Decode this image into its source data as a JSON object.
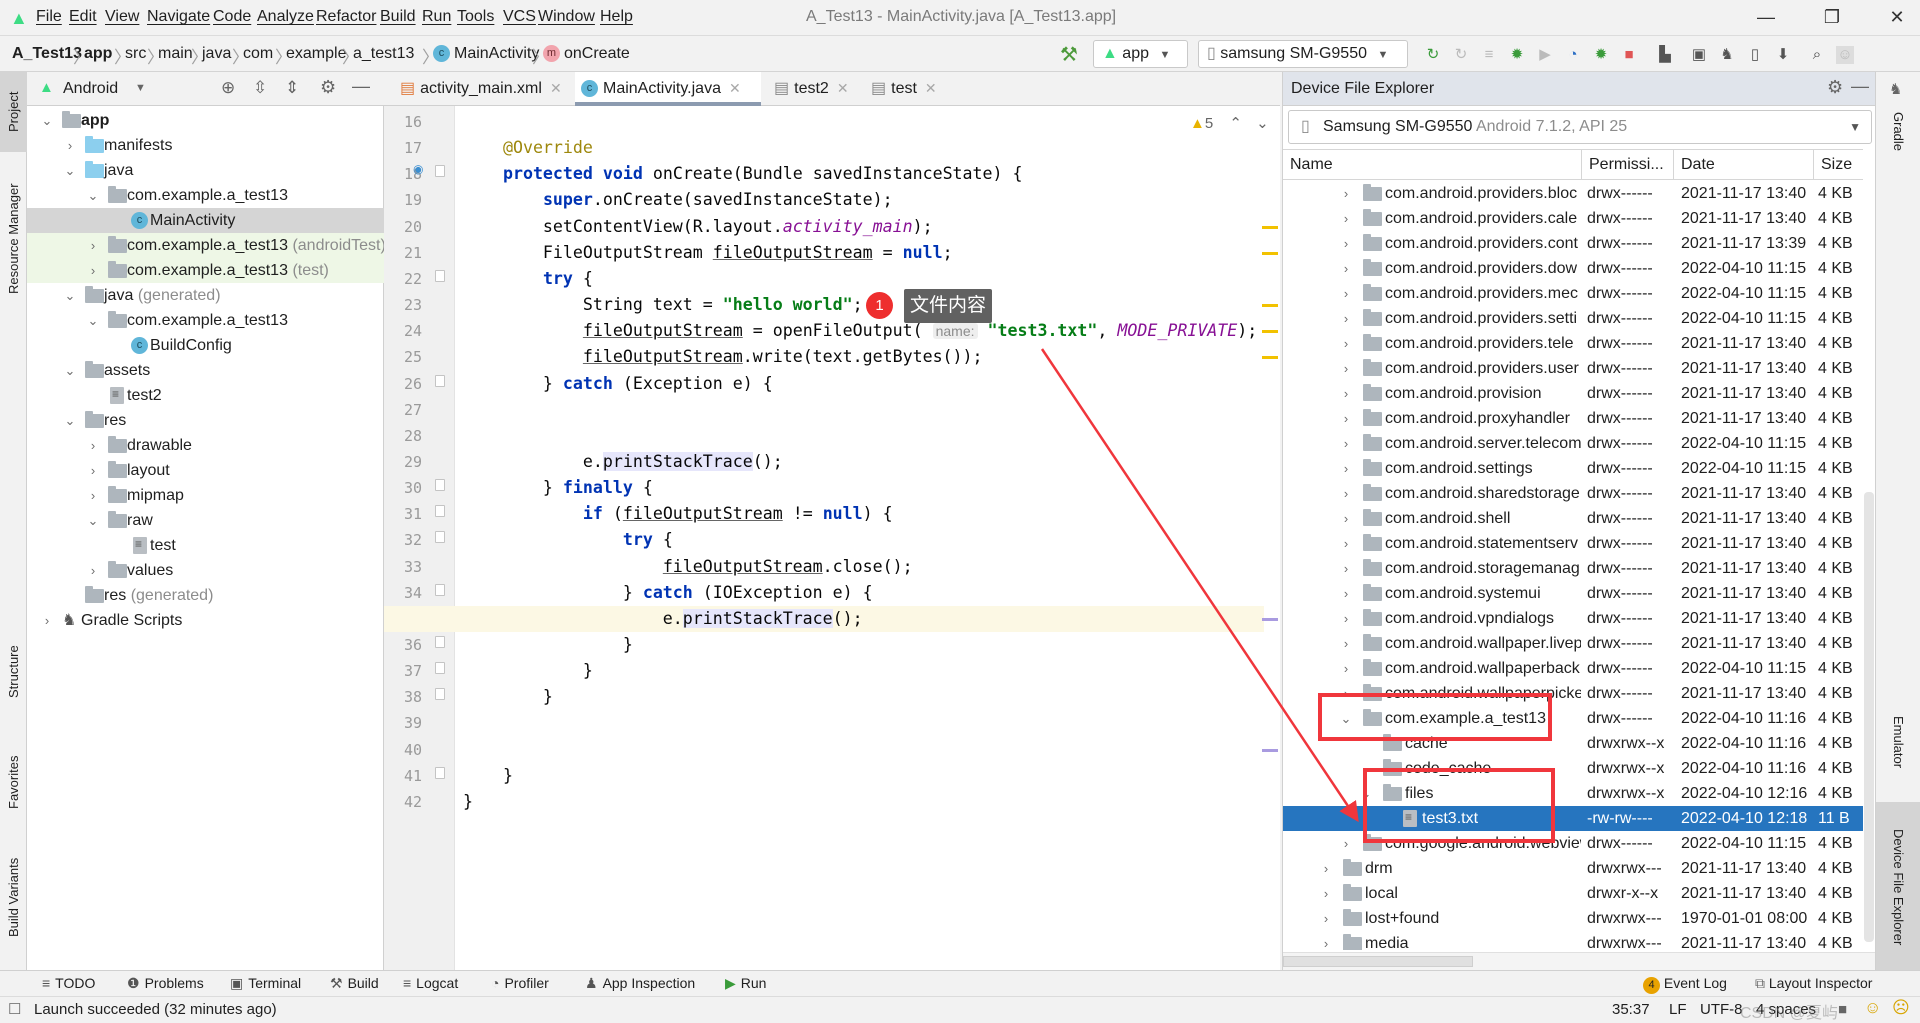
{
  "window": {
    "title": "A_Test13 - MainActivity.java [A_Test13.app]",
    "minimize": "—",
    "maximize": "❐",
    "close": "✕"
  },
  "menu": [
    "File",
    "Edit",
    "View",
    "Navigate",
    "Code",
    "Analyze",
    "Refactor",
    "Build",
    "Run",
    "Tools",
    "VCS",
    "Window",
    "Help"
  ],
  "breadcrumb": [
    "A_Test13",
    "app",
    "src",
    "main",
    "java",
    "com",
    "example",
    "a_test13",
    "MainActivity",
    "onCreate"
  ],
  "toolbar": {
    "run_config": "app",
    "device": "samsung SM-G9550"
  },
  "left_strip": {
    "project": "Project",
    "resource_manager": "Resource Manager",
    "structure": "Structure",
    "favorites": "Favorites",
    "build_variants": "Build Variants"
  },
  "project_panel": {
    "view": "Android",
    "tree": [
      {
        "d": 0,
        "exp": true,
        "icon": "module",
        "name": "app",
        "bold": true
      },
      {
        "d": 1,
        "exp": false,
        "icon": "folder-blue",
        "name": "manifests"
      },
      {
        "d": 1,
        "exp": true,
        "icon": "folder-blue",
        "name": "java"
      },
      {
        "d": 2,
        "exp": true,
        "icon": "package",
        "name": "com.example.a_test13"
      },
      {
        "d": 3,
        "icon": "class",
        "name": "MainActivity",
        "selected": true
      },
      {
        "d": 2,
        "exp": false,
        "icon": "package",
        "name": "com.example.a_test13",
        "sub": "(androidTest)",
        "green": true
      },
      {
        "d": 2,
        "exp": false,
        "icon": "package",
        "name": "com.example.a_test13",
        "sub": "(test)",
        "green": true
      },
      {
        "d": 1,
        "exp": true,
        "icon": "folder-gen",
        "name": "java",
        "sub": "(generated)"
      },
      {
        "d": 2,
        "exp": true,
        "icon": "package",
        "name": "com.example.a_test13"
      },
      {
        "d": 3,
        "icon": "class",
        "name": "BuildConfig"
      },
      {
        "d": 1,
        "exp": true,
        "icon": "folder-res",
        "name": "assets"
      },
      {
        "d": 2,
        "icon": "file",
        "name": "test2"
      },
      {
        "d": 1,
        "exp": true,
        "icon": "folder-res",
        "name": "res"
      },
      {
        "d": 2,
        "exp": false,
        "icon": "package",
        "name": "drawable"
      },
      {
        "d": 2,
        "exp": false,
        "icon": "package",
        "name": "layout"
      },
      {
        "d": 2,
        "exp": false,
        "icon": "package",
        "name": "mipmap"
      },
      {
        "d": 2,
        "exp": true,
        "icon": "package",
        "name": "raw"
      },
      {
        "d": 3,
        "icon": "file",
        "name": "test"
      },
      {
        "d": 2,
        "exp": false,
        "icon": "package",
        "name": "values"
      },
      {
        "d": 1,
        "icon": "folder-res",
        "name": "res",
        "sub": "(generated)"
      },
      {
        "d": 0,
        "exp": false,
        "icon": "gradle",
        "name": "Gradle Scripts"
      }
    ]
  },
  "editor": {
    "tabs": [
      {
        "label": "activity_main.xml"
      },
      {
        "label": "MainActivity.java",
        "active": true
      },
      {
        "label": "test2"
      },
      {
        "label": "test"
      }
    ],
    "warnings": "5",
    "first_line": 16,
    "current_line": 35,
    "lines": [
      [],
      [
        [
          "    ",
          ""
        ],
        [
          "@Override",
          "ann"
        ]
      ],
      [
        [
          "    ",
          ""
        ],
        [
          "protected",
          "kw"
        ],
        [
          " ",
          ""
        ],
        [
          "void",
          "kw"
        ],
        [
          " onCreate(Bundle savedInstanceState) {",
          ""
        ]
      ],
      [
        [
          "        ",
          ""
        ],
        [
          "super",
          "kw"
        ],
        [
          ".onCreate(savedInstanceState);",
          ""
        ]
      ],
      [
        [
          "        setContentView(R.layout.",
          ""
        ],
        [
          "activity_main",
          "fld"
        ],
        [
          ");",
          ""
        ]
      ],
      [
        [
          "        FileOutputStream ",
          ""
        ],
        [
          "fileOutputStream",
          "und"
        ],
        [
          " = ",
          ""
        ],
        [
          "null",
          "kw"
        ],
        [
          ";",
          ""
        ]
      ],
      [
        [
          "        ",
          ""
        ],
        [
          "try",
          "kw"
        ],
        [
          " {",
          ""
        ]
      ],
      [
        [
          "            String text = ",
          ""
        ],
        [
          "\"hello world\"",
          "str"
        ],
        [
          ";",
          ""
        ]
      ],
      [
        [
          "            ",
          ""
        ],
        [
          "fileOutputStream",
          "und"
        ],
        [
          " = openFileOutput( ",
          ""
        ],
        [
          "name:",
          "hint"
        ],
        [
          " ",
          ""
        ],
        [
          "\"test3.txt\"",
          "str"
        ],
        [
          ", ",
          ""
        ],
        [
          "MODE_PRIVATE",
          "fld"
        ],
        [
          ");",
          ""
        ]
      ],
      [
        [
          "            ",
          ""
        ],
        [
          "fileOutputStream",
          "und"
        ],
        [
          ".write(text.getBytes());",
          ""
        ]
      ],
      [
        [
          "        } ",
          ""
        ],
        [
          "catch",
          "kw"
        ],
        [
          " (Exception e) {",
          ""
        ]
      ],
      [],
      [],
      [
        [
          "            e.",
          ""
        ],
        [
          "printStackTrace",
          "hl"
        ],
        [
          "();",
          ""
        ]
      ],
      [
        [
          "        } ",
          ""
        ],
        [
          "finally",
          "kw"
        ],
        [
          " {",
          ""
        ]
      ],
      [
        [
          "            ",
          ""
        ],
        [
          "if",
          "kw"
        ],
        [
          " (",
          ""
        ],
        [
          "fileOutputStream",
          "und"
        ],
        [
          " != ",
          ""
        ],
        [
          "null",
          "kw"
        ],
        [
          ") {",
          ""
        ]
      ],
      [
        [
          "                ",
          ""
        ],
        [
          "try",
          "kw"
        ],
        [
          " {",
          ""
        ]
      ],
      [
        [
          "                    ",
          ""
        ],
        [
          "fileOutputStream",
          "und"
        ],
        [
          ".close();",
          ""
        ]
      ],
      [
        [
          "                } ",
          ""
        ],
        [
          "catch",
          "kw"
        ],
        [
          " (IOException e) {",
          ""
        ]
      ],
      [
        [
          "                    e.",
          ""
        ],
        [
          "printStackTrace",
          "hl"
        ],
        [
          "();",
          ""
        ]
      ],
      [
        [
          "                }",
          ""
        ]
      ],
      [
        [
          "            }",
          ""
        ]
      ],
      [
        [
          "        }",
          ""
        ]
      ],
      [],
      [],
      [
        [
          "    }",
          ""
        ]
      ],
      [
        [
          "}",
          ""
        ]
      ]
    ]
  },
  "device_explorer": {
    "title": "Device File Explorer",
    "device": "Samsung SM-G9550",
    "device_detail": "Android 7.1.2, API 25",
    "columns": [
      "Name",
      "Permissi...",
      "Date",
      "Size"
    ],
    "rows": [
      {
        "d": 2,
        "exp": false,
        "name": "com.android.providers.bloc",
        "perm": "drwx------",
        "date": "2021-11-17 13:40",
        "size": "4 KB"
      },
      {
        "d": 2,
        "exp": false,
        "name": "com.android.providers.cale",
        "perm": "drwx------",
        "date": "2021-11-17 13:40",
        "size": "4 KB"
      },
      {
        "d": 2,
        "exp": false,
        "name": "com.android.providers.cont",
        "perm": "drwx------",
        "date": "2021-11-17 13:39",
        "size": "4 KB"
      },
      {
        "d": 2,
        "exp": false,
        "name": "com.android.providers.dow",
        "perm": "drwx------",
        "date": "2022-04-10 11:15",
        "size": "4 KB"
      },
      {
        "d": 2,
        "exp": false,
        "name": "com.android.providers.mec",
        "perm": "drwx------",
        "date": "2022-04-10 11:15",
        "size": "4 KB"
      },
      {
        "d": 2,
        "exp": false,
        "name": "com.android.providers.setti",
        "perm": "drwx------",
        "date": "2022-04-10 11:15",
        "size": "4 KB"
      },
      {
        "d": 2,
        "exp": false,
        "name": "com.android.providers.tele",
        "perm": "drwx------",
        "date": "2021-11-17 13:40",
        "size": "4 KB"
      },
      {
        "d": 2,
        "exp": false,
        "name": "com.android.providers.user",
        "perm": "drwx------",
        "date": "2021-11-17 13:40",
        "size": "4 KB"
      },
      {
        "d": 2,
        "exp": false,
        "name": "com.android.provision",
        "perm": "drwx------",
        "date": "2021-11-17 13:40",
        "size": "4 KB"
      },
      {
        "d": 2,
        "exp": false,
        "name": "com.android.proxyhandler",
        "perm": "drwx------",
        "date": "2021-11-17 13:40",
        "size": "4 KB"
      },
      {
        "d": 2,
        "exp": false,
        "name": "com.android.server.telecom",
        "perm": "drwx------",
        "date": "2022-04-10 11:15",
        "size": "4 KB"
      },
      {
        "d": 2,
        "exp": false,
        "name": "com.android.settings",
        "perm": "drwx------",
        "date": "2022-04-10 11:15",
        "size": "4 KB"
      },
      {
        "d": 2,
        "exp": false,
        "name": "com.android.sharedstorage",
        "perm": "drwx------",
        "date": "2021-11-17 13:40",
        "size": "4 KB"
      },
      {
        "d": 2,
        "exp": false,
        "name": "com.android.shell",
        "perm": "drwx------",
        "date": "2021-11-17 13:40",
        "size": "4 KB"
      },
      {
        "d": 2,
        "exp": false,
        "name": "com.android.statementserv",
        "perm": "drwx------",
        "date": "2021-11-17 13:40",
        "size": "4 KB"
      },
      {
        "d": 2,
        "exp": false,
        "name": "com.android.storagemanag",
        "perm": "drwx------",
        "date": "2021-11-17 13:40",
        "size": "4 KB"
      },
      {
        "d": 2,
        "exp": false,
        "name": "com.android.systemui",
        "perm": "drwx------",
        "date": "2021-11-17 13:40",
        "size": "4 KB"
      },
      {
        "d": 2,
        "exp": false,
        "name": "com.android.vpndialogs",
        "perm": "drwx------",
        "date": "2021-11-17 13:40",
        "size": "4 KB"
      },
      {
        "d": 2,
        "exp": false,
        "name": "com.android.wallpaper.livep",
        "perm": "drwx------",
        "date": "2021-11-17 13:40",
        "size": "4 KB"
      },
      {
        "d": 2,
        "exp": false,
        "name": "com.android.wallpaperback",
        "perm": "drwx------",
        "date": "2022-04-10 11:15",
        "size": "4 KB"
      },
      {
        "d": 2,
        "exp": false,
        "name": "com.android.wallpaperpicker",
        "perm": "drwx------",
        "date": "2021-11-17 13:40",
        "size": "4 KB"
      },
      {
        "d": 2,
        "exp": true,
        "name": "com.example.a_test13",
        "perm": "drwx------",
        "date": "2022-04-10 11:16",
        "size": "4 KB"
      },
      {
        "d": 3,
        "name": "cache",
        "perm": "drwxrwx--x",
        "date": "2022-04-10 11:16",
        "size": "4 KB"
      },
      {
        "d": 3,
        "name": "code_cache",
        "perm": "drwxrwx--x",
        "date": "2022-04-10 11:16",
        "size": "4 KB"
      },
      {
        "d": 3,
        "exp": true,
        "name": "files",
        "perm": "drwxrwx--x",
        "date": "2022-04-10 12:16",
        "size": "4 KB"
      },
      {
        "d": 4,
        "file": true,
        "name": "test3.txt",
        "perm": "-rw-rw----",
        "date": "2022-04-10 12:18",
        "size": "11 B",
        "selected": true
      },
      {
        "d": 2,
        "exp": false,
        "name": "com.google.android.webview",
        "perm": "drwx------",
        "date": "2022-04-10 11:15",
        "size": "4 KB"
      },
      {
        "d": 1,
        "exp": false,
        "name": "drm",
        "perm": "drwxrwx---",
        "date": "2021-11-17 13:40",
        "size": "4 KB"
      },
      {
        "d": 1,
        "exp": false,
        "name": "local",
        "perm": "drwxr-x--x",
        "date": "2021-11-17 13:40",
        "size": "4 KB"
      },
      {
        "d": 1,
        "exp": false,
        "name": "lost+found",
        "perm": "drwxrwx---",
        "date": "1970-01-01 08:00",
        "size": "4 KB"
      },
      {
        "d": 1,
        "exp": false,
        "name": "media",
        "perm": "drwxrwx---",
        "date": "2021-11-17 13:40",
        "size": "4 KB"
      }
    ]
  },
  "right_strip": {
    "gradle": "Gradle",
    "emulator": "Emulator",
    "device_file_explorer": "Device File Explorer"
  },
  "bottom_tools": [
    "TODO",
    "Problems",
    "Terminal",
    "Build",
    "Logcat",
    "Profiler",
    "App Inspection",
    "Run"
  ],
  "event_log": {
    "count": "4",
    "label": "Event Log"
  },
  "layout_inspector": "Layout Inspector",
  "status": {
    "message": "Launch succeeded (32 minutes ago)",
    "position": "35:37",
    "line_sep": "LF",
    "encoding": "UTF-8",
    "indent": "4 spaces"
  },
  "annotation": {
    "number": "1",
    "text": "文件内容",
    "color": "#f0363c"
  },
  "watermark": "CSDN @夏屿",
  "colors": {
    "selection": "#2675bf",
    "keyword": "#0033b3",
    "string": "#067d17",
    "annotation_red": "#f0363c"
  }
}
